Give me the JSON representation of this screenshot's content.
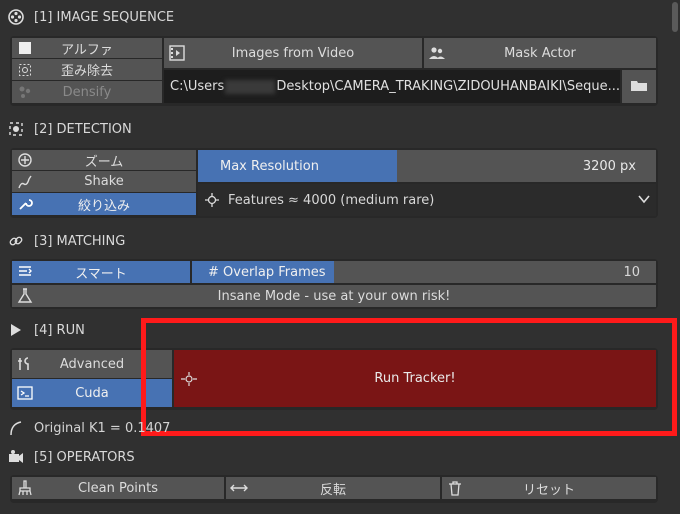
{
  "scrollbar": {},
  "section1": {
    "title": "[1] IMAGE SEQUENCE",
    "modes": [
      "アルファ",
      "歪み除去",
      "Densify"
    ],
    "images_from_video": "Images from Video",
    "mask_actor": "Mask Actor",
    "path_prefix": "C:\\Users",
    "path_suffix": "Desktop\\CAMERA_TRAKING\\ZIDOUHANBAIKI\\Seque..."
  },
  "section2": {
    "title": "[2] DETECTION",
    "modes": [
      "ズーム",
      "Shake",
      "絞り込み"
    ],
    "max_resolution_label": "Max Resolution",
    "max_resolution_value": "3200 px",
    "features_label": "Features ≈ 4000 (medium rare)"
  },
  "section3": {
    "title": "[3] MATCHING",
    "mode": "スマート",
    "overlap_label": "# Overlap Frames",
    "overlap_value": "10",
    "insane_mode": "Insane Mode - use at your own risk!"
  },
  "section4": {
    "title": "[4] RUN",
    "advanced": "Advanced",
    "cuda": "Cuda",
    "run_tracker": "Run Tracker!",
    "original_k1": "Original K1 = 0.1407"
  },
  "section5": {
    "title": "[5] OPERATORS",
    "clean_points": "Clean Points",
    "flip": "反転",
    "reset": "リセット"
  },
  "colors": {
    "accent_blue": "#4772b3",
    "run_red": "#7a1515",
    "highlight_red": "#ff1a1a"
  }
}
